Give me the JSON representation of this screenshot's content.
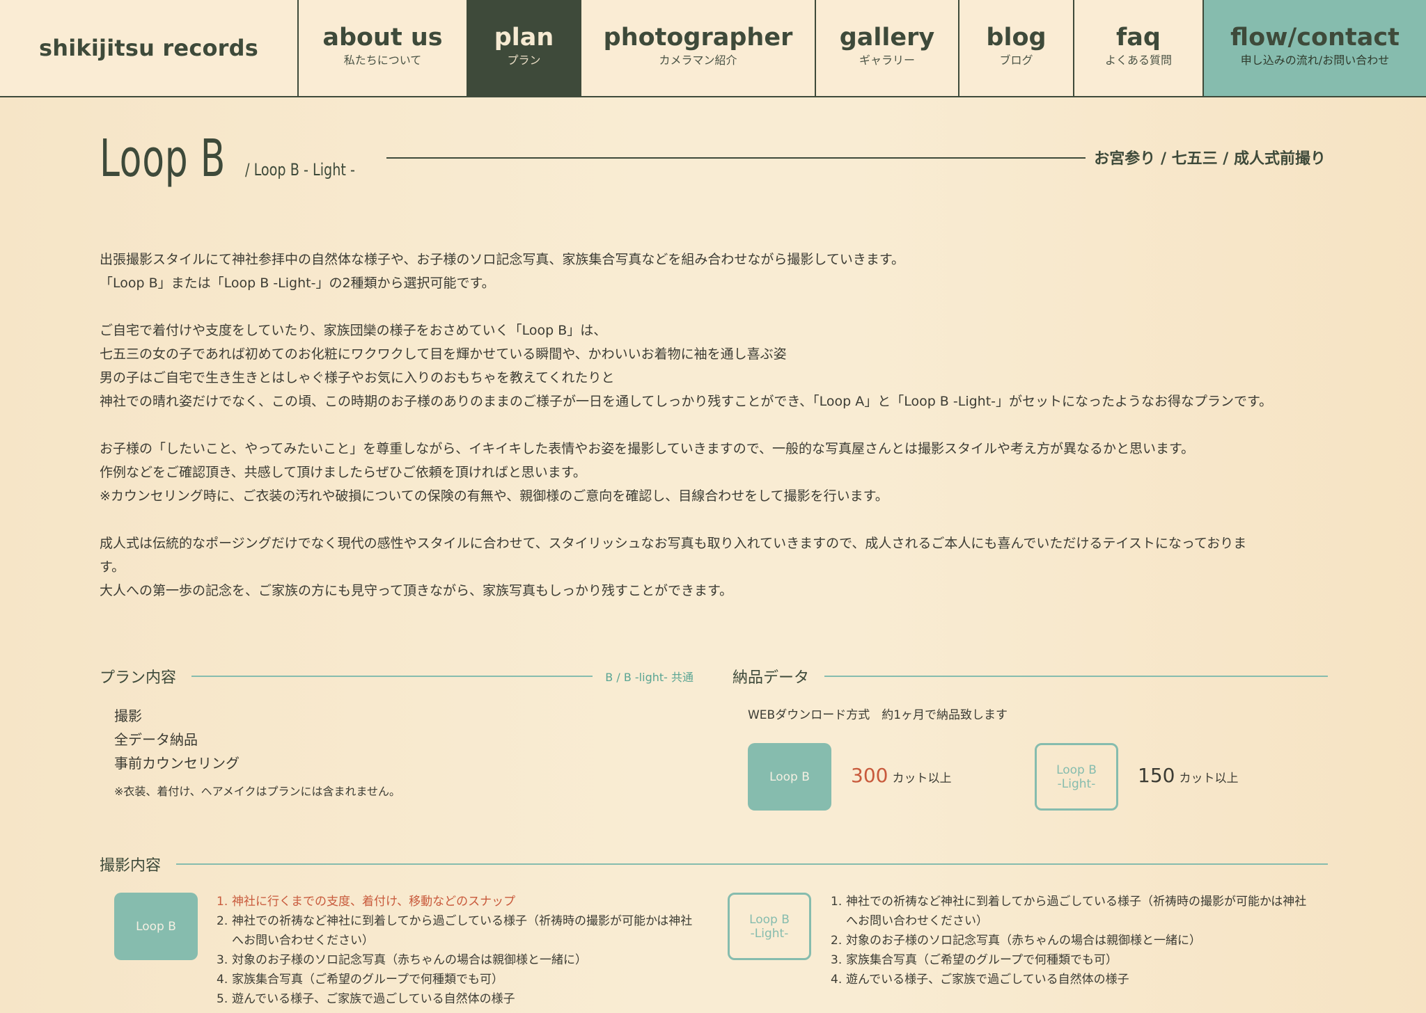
{
  "nav": {
    "brand": "shikijitsu records",
    "items": [
      {
        "en": "about us",
        "jp": "私たちについて"
      },
      {
        "en": "plan",
        "jp": "プラン"
      },
      {
        "en": "photographer",
        "jp": "カメラマン紹介"
      },
      {
        "en": "gallery",
        "jp": "ギャラリー"
      },
      {
        "en": "blog",
        "jp": "ブログ"
      },
      {
        "en": "faq",
        "jp": "よくある質問"
      },
      {
        "en": "flow/contact",
        "jp": "申し込みの流れ/お問い合わせ"
      }
    ]
  },
  "title": {
    "main": "Loop B",
    "sub": "/ Loop B - Light -",
    "tag": "お宮参り / 七五三 / 成人式前撮り"
  },
  "description": [
    [
      "出張撮影スタイルにて神社参拝中の自然体な様子や、お子様のソロ記念写真、家族集合写真などを組み合わせながら撮影していきます。",
      "「Loop B」または「Loop B -Light-」の2種類から選択可能です。"
    ],
    [
      "ご自宅で着付けや支度をしていたり、家族団欒の様子をおさめていく「Loop B」は、",
      "七五三の女の子であれば初めてのお化粧にワクワクして目を輝かせている瞬間や、かわいいお着物に袖を通し喜ぶ姿",
      "男の子はご自宅で生き生きとはしゃぐ様子やお気に入りのおもちゃを教えてくれたりと",
      "神社での晴れ姿だけでなく、この頃、この時期のお子様のありのままのご様子が一日を通してしっかり残すことができ、「Loop A」と「Loop B -Light-」がセットになったようなお得なプランです。"
    ],
    [
      "お子様の「したいこと、やってみたいこと」を尊重しながら、イキイキした表情やお姿を撮影していきますので、一般的な写真屋さんとは撮影スタイルや考え方が異なるかと思います。",
      "作例などをご確認頂き、共感して頂けましたらぜひご依頼を頂ければと思います。",
      "※カウンセリング時に、ご衣装の汚れや破損についての保険の有無や、親御様のご意向を確認し、目線合わせをして撮影を行います。"
    ],
    [
      "成人式は伝統的なポージングだけでなく現代の感性やスタイルに合わせて、スタイリッシュなお写真も取り入れていきますので、成人されるご本人にも喜んでいただけるテイストになっておりま",
      "す。",
      "大人への第一歩の記念を、ご家族の方にも見守って頂きながら、家族写真もしっかり残すことができます。"
    ]
  ],
  "plan": {
    "heading": "プラン内容",
    "note": "B / B -light- 共通",
    "items": [
      "撮影",
      "全データ納品",
      "事前カウンセリング"
    ],
    "footnote": "※衣装、着付け、ヘアメイクはプランには含まれません。"
  },
  "delivery": {
    "heading": "納品データ",
    "text": "WEBダウンロード方式　約1ヶ月で納品致します",
    "options": [
      {
        "badge": "Loop B",
        "count": "300",
        "unit": "カット以上"
      },
      {
        "badge_line1": "Loop B",
        "badge_line2": "-Light-",
        "count": "150",
        "unit": "カット以上"
      }
    ]
  },
  "shooting": {
    "heading": "撮影内容",
    "loop_b": {
      "badge": "Loop B",
      "items": [
        {
          "n": "1.",
          "text": "神社に行くまでの支度、着付け、移動などのスナップ"
        },
        {
          "n": "2.",
          "text": "神社での祈祷など神社に到着してから過ごしている様子（祈祷時の撮影が可能かは神社",
          "cont": "へお問い合わせください）"
        },
        {
          "n": "3.",
          "text": "対象のお子様のソロ記念写真（赤ちゃんの場合は親御様と一緒に）"
        },
        {
          "n": "4.",
          "text": "家族集合写真（ご希望のグループで何種類でも可）"
        },
        {
          "n": "5.",
          "text": "遊んでいる様子、ご家族で過ごしている自然体の様子"
        }
      ]
    },
    "loop_b_light": {
      "badge_line1": "Loop B",
      "badge_line2": "-Light-",
      "items": [
        {
          "n": "1.",
          "text": "神社での祈祷など神社に到着してから過ごしている様子（祈祷時の撮影が可能かは神社",
          "cont": "へお問い合わせください）"
        },
        {
          "n": "2.",
          "text": "対象のお子様のソロ記念写真（赤ちゃんの場合は親御様と一緒に）"
        },
        {
          "n": "3.",
          "text": "家族集合写真（ご希望のグループで何種類でも可）"
        },
        {
          "n": "4.",
          "text": "遊んでいる様子、ご家族で過ごしている自然体の様子"
        }
      ]
    }
  },
  "colors": {
    "dark_green": "#3e4a3a",
    "teal": "#86bcae",
    "accent_red": "#c85a3c",
    "background": "#f9ecd3"
  }
}
